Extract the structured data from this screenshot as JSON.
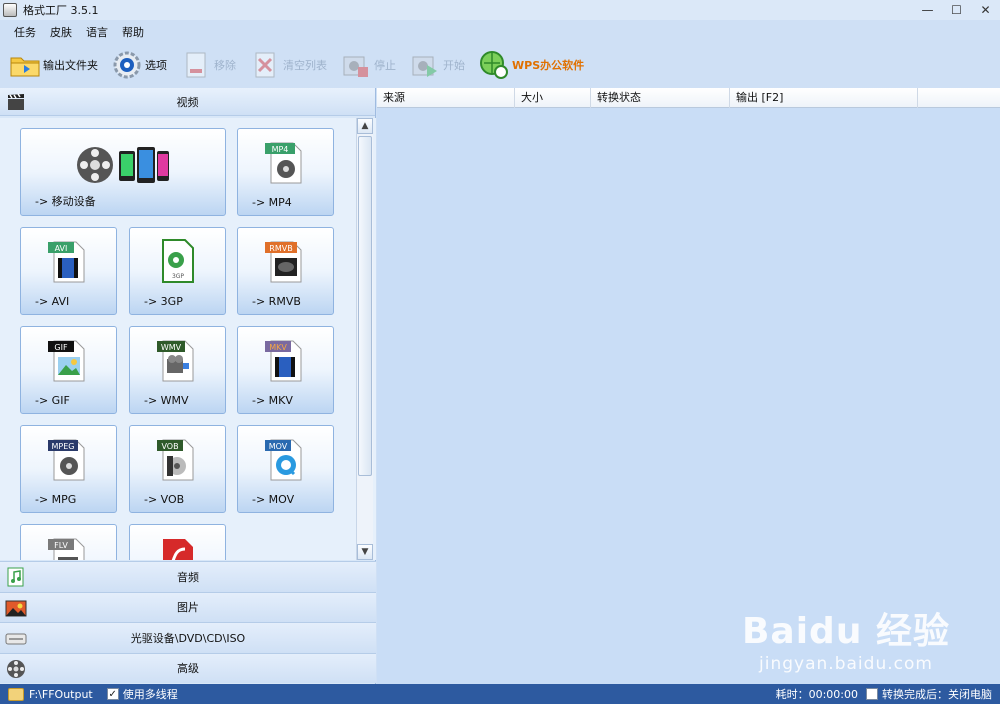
{
  "window": {
    "title": "格式工厂 3.5.1",
    "minimize": "—",
    "maximize": "☐",
    "close": "✕"
  },
  "menu": [
    "任务",
    "皮肤",
    "语言",
    "帮助"
  ],
  "toolbar": {
    "output_folder": "输出文件夹",
    "options": "选项",
    "remove": "移除",
    "clear_list": "清空列表",
    "stop": "停止",
    "start": "开始",
    "wps": "WPS办公软件"
  },
  "left": {
    "video_header": "视频",
    "tiles": [
      {
        "label": "-> 移动设备",
        "badge": ""
      },
      {
        "label": "-> MP4",
        "badge": "MP4"
      },
      {
        "label": "-> AVI",
        "badge": "AVI"
      },
      {
        "label": "-> 3GP",
        "badge": "3GP"
      },
      {
        "label": "-> RMVB",
        "badge": "RMVB"
      },
      {
        "label": "-> GIF",
        "badge": "GIF"
      },
      {
        "label": "-> WMV",
        "badge": "WMV"
      },
      {
        "label": "-> MKV",
        "badge": "MKV"
      },
      {
        "label": "-> MPG",
        "badge": "MPEG"
      },
      {
        "label": "-> VOB",
        "badge": "VOB"
      },
      {
        "label": "-> MOV",
        "badge": "MOV"
      },
      {
        "label": "",
        "badge": "FLV"
      },
      {
        "label": "",
        "badge": ""
      }
    ],
    "categories": [
      "音频",
      "图片",
      "光驱设备\\DVD\\CD\\ISO",
      "高级"
    ]
  },
  "right": {
    "columns": [
      "来源",
      "大小",
      "转换状态",
      "输出 [F2]",
      ""
    ],
    "watermark_logo": "Baidu 经验",
    "watermark_url": "jingyan.baidu.com"
  },
  "status": {
    "output_path": "F:\\FFOutput",
    "multithread_label": "使用多线程",
    "multithread_checked": "✓",
    "elapsed": "耗时：00:00:00",
    "after_convert": "转换完成后：关闭电脑"
  },
  "colors": {
    "accent": "#2d5aa0",
    "tile_border": "#8fb3e0",
    "wps_orange": "#e07000"
  }
}
